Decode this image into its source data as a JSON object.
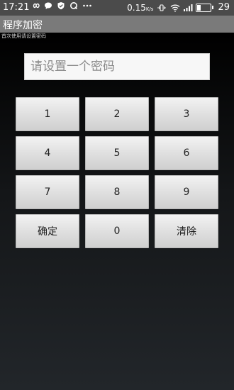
{
  "status_bar": {
    "time": "17:21",
    "left_icons": [
      "infinity-icon",
      "chat-bubble-icon",
      "shield-check-icon",
      "q-app-icon",
      "more-dots-icon"
    ],
    "network_speed": "0.15",
    "network_unit": "K/s",
    "right_icons": [
      "vibrate-icon",
      "wifi-icon",
      "signal-icon"
    ],
    "battery_level": "29",
    "battery_fraction": 0.29
  },
  "app": {
    "title": "程序加密"
  },
  "main": {
    "hint": "首次使用请设置密码",
    "password_placeholder": "请设置一个密码"
  },
  "keypad": {
    "keys": [
      "1",
      "2",
      "3",
      "4",
      "5",
      "6",
      "7",
      "8",
      "9",
      "确定",
      "0",
      "清除"
    ]
  },
  "colors": {
    "status_bar_bg": "#4b4b4b",
    "title_bar_bg": "#7a7a7a",
    "key_bg": "#dedede"
  }
}
